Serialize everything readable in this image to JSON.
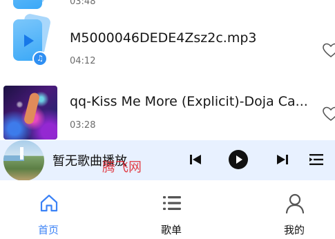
{
  "song_list": {
    "items": [
      {
        "title": "",
        "duration": "03:48",
        "thumb": "audio-file-icon"
      },
      {
        "title": "M5000046DEDE4Zsz2c.mp3",
        "duration": "04:12",
        "thumb": "audio-file-icon",
        "favorite_icon": "heart-outline-icon"
      },
      {
        "title": "qq-Kiss Me More (Explicit)-Doja Ca...",
        "duration": "03:28",
        "thumb": "album-cover",
        "favorite_icon": "heart-outline-icon"
      }
    ]
  },
  "player": {
    "now_playing": "暂无歌曲播放",
    "watermark": "腾飞网",
    "controls": [
      "skip-previous-icon",
      "play-icon",
      "skip-next-icon",
      "playlist-queue-icon"
    ]
  },
  "bottom_nav": {
    "items": [
      {
        "label": "首页",
        "icon": "home-icon",
        "active": true
      },
      {
        "label": "歌单",
        "icon": "list-icon",
        "active": false
      },
      {
        "label": "我的",
        "icon": "user-icon",
        "active": false
      }
    ]
  },
  "colors": {
    "accent": "#3b82f6",
    "player_background": "#e8f1ff",
    "watermark": "#e0202a"
  }
}
